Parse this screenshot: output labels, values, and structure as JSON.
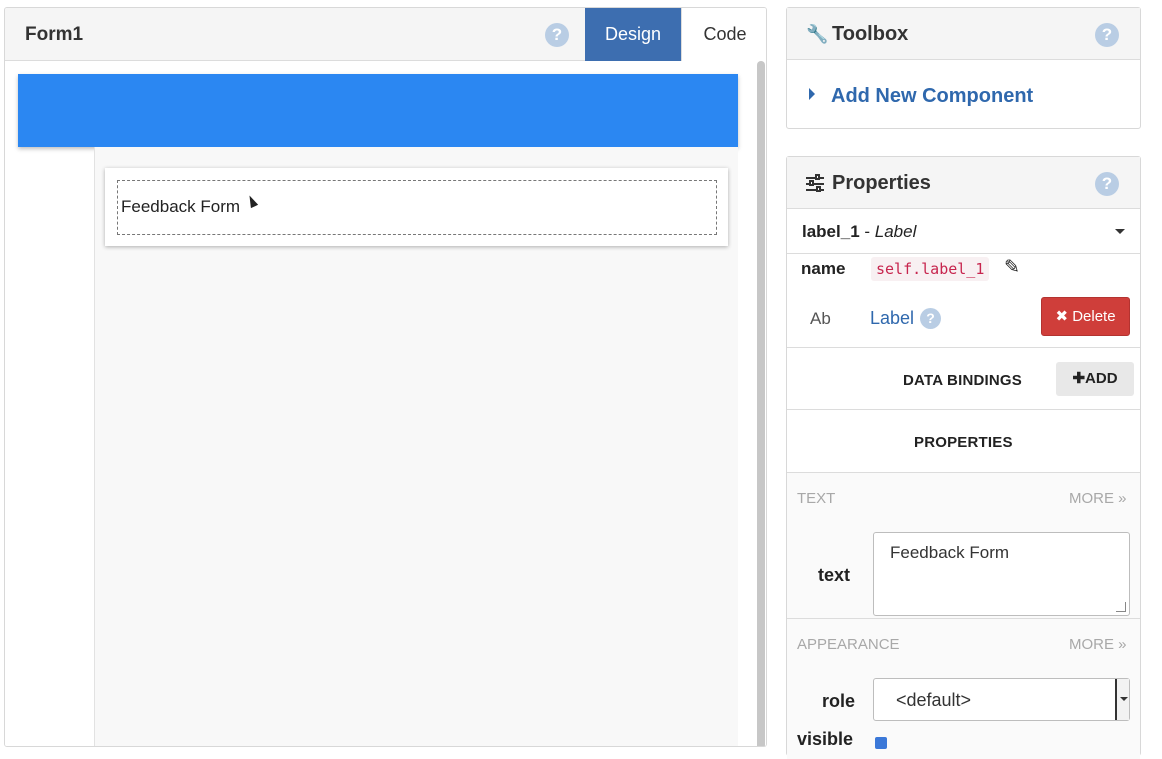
{
  "designer": {
    "form_title": "Form1",
    "help_glyph": "?",
    "tabs": [
      {
        "label": "Design",
        "active": true
      },
      {
        "label": "Code",
        "active": false
      }
    ],
    "canvas": {
      "appbar_color": "#2b87f2",
      "label_text": "Feedback Form"
    }
  },
  "toolbox": {
    "title": "Toolbox",
    "icon": "wrench-icon",
    "help_glyph": "?",
    "add_component_label": "Add New Component"
  },
  "properties": {
    "title": "Properties",
    "icon": "sliders-icon",
    "help_glyph": "?",
    "selected_component": {
      "name": "label_1",
      "separator": " - ",
      "type": "Label"
    },
    "name_label": "name",
    "name_value": "self.label_1",
    "component_icon_text": "Ab",
    "component_type_link": "Label",
    "delete_label": "Delete",
    "delete_color": "#cf3e3a",
    "data_bindings_label": "DATA BINDINGS",
    "add_label": "ADD",
    "properties_label": "PROPERTIES",
    "groups": {
      "text": {
        "label": "TEXT",
        "more": "MORE"
      },
      "appearance": {
        "label": "APPEARANCE",
        "more": "MORE"
      }
    },
    "text_prop": {
      "label": "text",
      "value": "Feedback Form"
    },
    "role_prop": {
      "label": "role",
      "value": "<default>"
    },
    "visible_prop": {
      "label": "visible",
      "checked": true
    }
  },
  "colors": {
    "accent": "#3d6eb0",
    "link": "#2f68ad"
  }
}
